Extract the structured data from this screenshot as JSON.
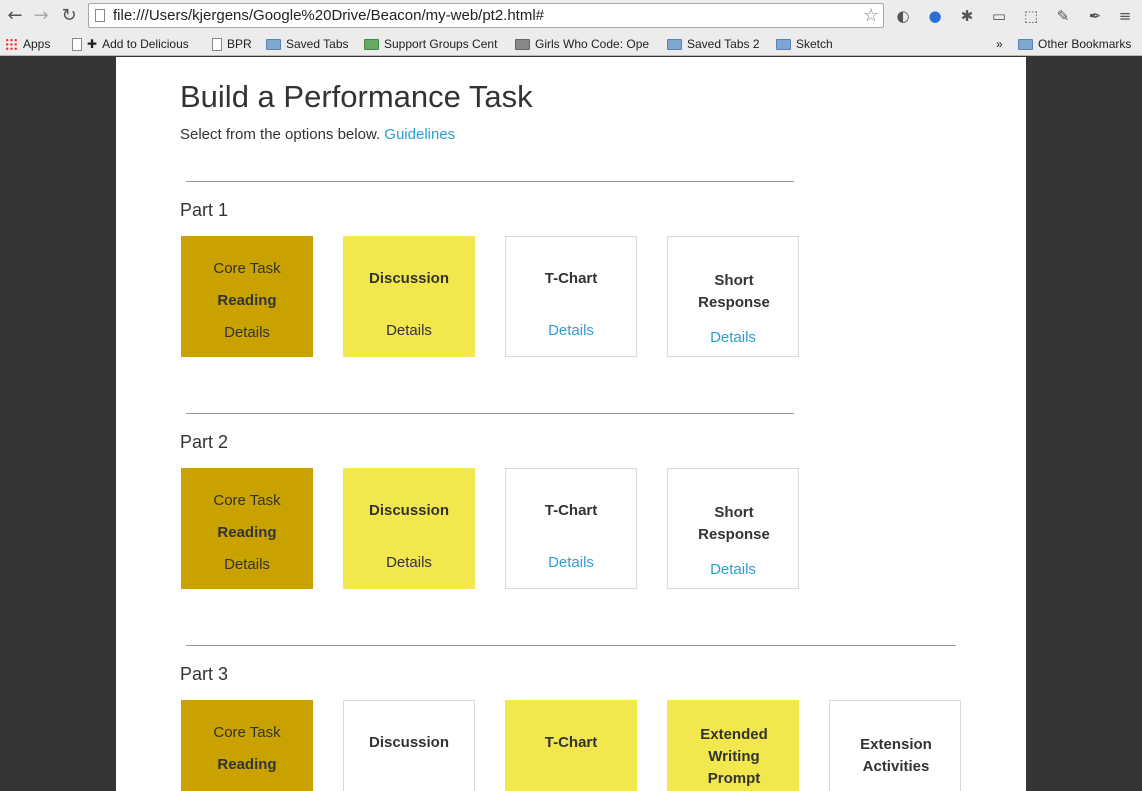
{
  "browser": {
    "url": "file:///Users/kjergens/Google%20Drive/Beacon/my-web/pt2.html#",
    "bookmarks": [
      "Apps",
      "Add to Delicious",
      "BPR",
      "Saved Tabs",
      "Support Groups Cent",
      "Girls Who Code: Ope",
      "Saved Tabs 2",
      "Sketch"
    ],
    "overflow": "»",
    "other_bookmarks": "Other Bookmarks"
  },
  "page": {
    "title": "Build a Performance Task",
    "subtitle": "Select from the options below.",
    "guidelines_link": "Guidelines"
  },
  "parts": [
    {
      "label": "Part 1",
      "tiles": [
        {
          "style": "core",
          "top": "Core Task",
          "title": "Reading",
          "details": "Details"
        },
        {
          "style": "yellow",
          "title": "Discussion",
          "details": "Details"
        },
        {
          "style": "white",
          "title": "T-Chart",
          "details": "Details"
        },
        {
          "style": "white",
          "title": "Short Response",
          "details": "Details"
        }
      ]
    },
    {
      "label": "Part 2",
      "tiles": [
        {
          "style": "core",
          "top": "Core Task",
          "title": "Reading",
          "details": "Details"
        },
        {
          "style": "yellow",
          "title": "Discussion",
          "details": "Details"
        },
        {
          "style": "white",
          "title": "T-Chart",
          "details": "Details"
        },
        {
          "style": "white",
          "title": "Short Response",
          "details": "Details"
        }
      ]
    },
    {
      "label": "Part 3",
      "tiles": [
        {
          "style": "core",
          "top": "Core Task",
          "title": "Reading"
        },
        {
          "style": "white",
          "title": "Discussion"
        },
        {
          "style": "yellow",
          "title": "T-Chart"
        },
        {
          "style": "yellow",
          "title": "Extended Writing Prompt"
        },
        {
          "style": "white",
          "title": "Extension Activities"
        }
      ]
    }
  ]
}
